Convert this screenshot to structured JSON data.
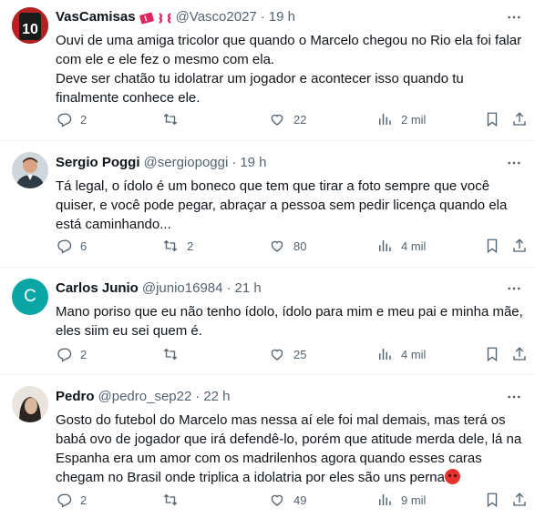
{
  "replies": [
    {
      "name": "VasCamisas",
      "handle": "@Vasco2027",
      "dot": "·",
      "time": "19 h",
      "text": "Ouvi de uma amiga tricolor que quando o Marcelo chegou no Rio ela foi falar com ele e ele fez o mesmo com ela.\nDeve ser chatão tu idolatrar um jogador e acontecer isso quando tu finalmente conhece ele.",
      "reply_count": "2",
      "retweet_count": "",
      "like_count": "22",
      "view_count": "2 mil",
      "badge_icons": [
        "ticket-emoji-icon",
        "anger-symbol-icon"
      ]
    },
    {
      "name": "Sergio Poggi",
      "handle": "@sergiopoggi",
      "dot": "·",
      "time": "19 h",
      "text": "Tá legal, o ídolo é um boneco que tem que tirar a foto sempre que você quiser, e você pode pegar, abraçar a pessoa sem pedir licença quando ela está caminhando...",
      "reply_count": "6",
      "retweet_count": "2",
      "like_count": "80",
      "view_count": "4 mil"
    },
    {
      "name": "Carlos Junio",
      "handle": "@junio16984",
      "dot": "·",
      "time": "21 h",
      "avatar_letter": "C",
      "text": "Mano poriso que eu não tenho ídolo, ídolo para mim e meu pai e minha mãe, eles siim eu sei quem é.",
      "reply_count": "2",
      "retweet_count": "",
      "like_count": "25",
      "view_count": "4 mil"
    },
    {
      "name": "Pedro",
      "handle": "@pedro_sep22",
      "dot": "·",
      "time": "22 h",
      "text": "Gosto do futebol do Marcelo mas nessa aí ele foi mal demais, mas terá os babá ovo de jogador que irá defendê-lo, porém que atitude merda dele, lá na Espanha era um amor com os madrilenhos agora quando esses caras chegam no Brasil onde triplica a idolatria por eles são uns perna",
      "reply_count": "2",
      "retweet_count": "",
      "like_count": "49",
      "view_count": "9 mil",
      "trailing_emoji": "angry-face-icon"
    }
  ],
  "colors": {
    "text": "#0f1419",
    "muted": "#536471",
    "divider": "#eff3f4",
    "avatar_teal": "#0aa5a5"
  }
}
